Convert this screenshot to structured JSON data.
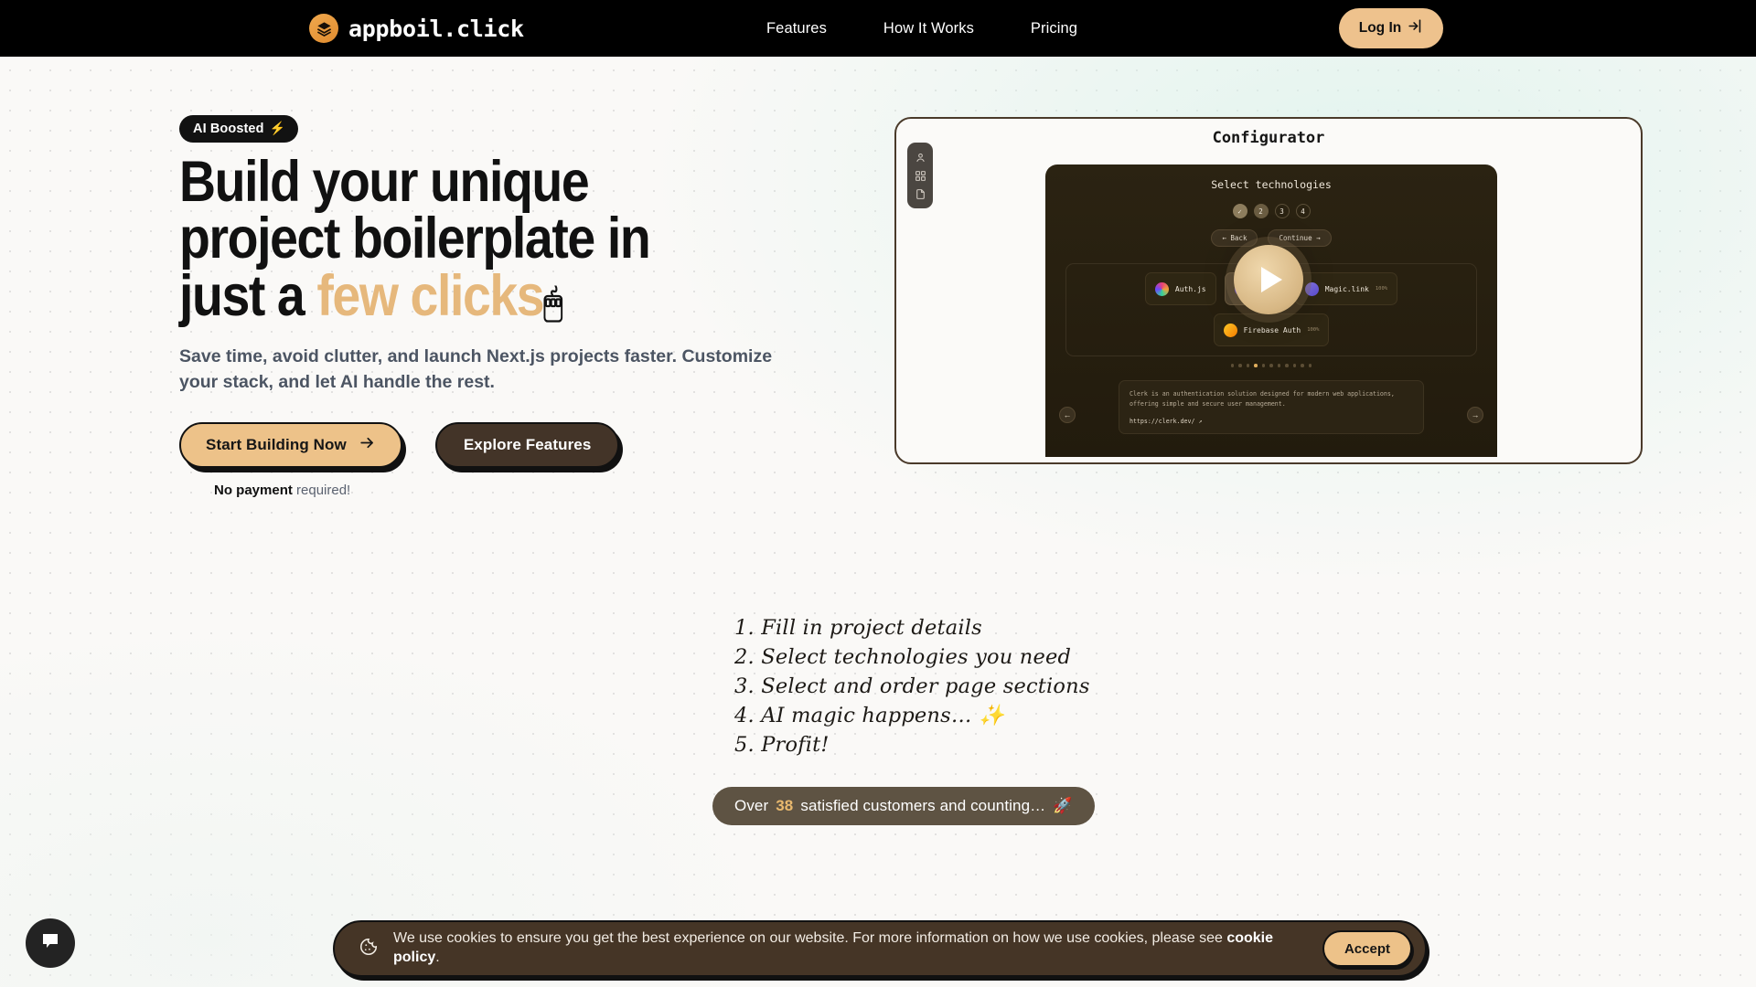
{
  "header": {
    "brand": {
      "name": "appboil.click",
      "icon": "layers-icon"
    },
    "nav": [
      {
        "label": "Features",
        "name": "nav-features"
      },
      {
        "label": "How It Works",
        "name": "nav-how-it-works"
      },
      {
        "label": "Pricing",
        "name": "nav-pricing"
      }
    ],
    "login": {
      "label": "Log In",
      "icon": "login-arrow-icon"
    }
  },
  "hero": {
    "badge": {
      "label": "AI Boosted",
      "emoji": "⚡"
    },
    "headline": {
      "line1": "Build your unique",
      "line2": "project boilerplate in",
      "line3_prefix": "just a ",
      "line3_accent": "few clicks",
      "cursor_emoji": "🖱"
    },
    "subtitle": "Save time, avoid clutter, and launch Next.js projects faster. Customize your stack, and let AI handle the rest.",
    "cta_primary": {
      "label": "Start Building Now",
      "icon": "arrow-right-icon"
    },
    "cta_secondary": {
      "label": "Explore Features"
    },
    "no_payment_bold": "No payment",
    "no_payment_rest": " required!"
  },
  "preview": {
    "title": "Configurator",
    "sidebar_icons": [
      "user-icon",
      "grid-icon",
      "document-icon"
    ],
    "panel_heading": "Select technologies",
    "steps": [
      {
        "label": "✓",
        "state": "done"
      },
      {
        "label": "2",
        "state": "cur"
      },
      {
        "label": "3",
        "state": "todo"
      },
      {
        "label": "4",
        "state": "todo"
      }
    ],
    "back_label": "← Back",
    "continue_label": "Continue →",
    "tech_cards_row1": [
      {
        "label": "Auth.js",
        "color1": "#e8407a",
        "color2": "#7b5cf0",
        "selected": false,
        "pct": ""
      },
      {
        "label": "Clerk",
        "color1": "#6c47ff",
        "color2": "#3b2bb8",
        "selected": true,
        "pct": ""
      },
      {
        "label": "Magic.link",
        "color1": "#7b68ee",
        "color2": "#5a4bd0",
        "selected": false,
        "pct": "100%"
      }
    ],
    "tech_cards_row2": [
      {
        "label": "Firebase Auth",
        "color1": "#ffca28",
        "color2": "#f57c00",
        "selected": false,
        "pct": "100%"
      }
    ],
    "description": "Clerk is an authentication solution designed for modern web applications, offering simple and secure user management.",
    "description_link": "https://clerk.dev/",
    "prev_arrow": "←",
    "next_arrow": "→",
    "play_button": "play-icon",
    "dots_total": 11,
    "dots_active": 4
  },
  "steps_list": [
    "1. Fill in project details",
    "2. Select technologies you need",
    "3. Select and order page sections",
    "4. AI magic happens…",
    "5. Profit!"
  ],
  "steps_sparkle": "✨",
  "customers": {
    "prefix": "Over ",
    "count": "38",
    "suffix": " satisfied customers and counting…",
    "emoji": "🚀"
  },
  "cookie": {
    "icon": "cookie-icon",
    "text_before": "We use cookies to ensure you get the best experience on our website. For more information on how we use cookies, please see ",
    "link": "cookie policy",
    "text_after": ".",
    "accept_label": "Accept"
  },
  "chat": {
    "icon": "chat-bubble-icon"
  },
  "colors": {
    "accent": "#e6b87c",
    "brand_orange": "#e08b2e",
    "dark_brown": "#453526",
    "header_bg": "#000000",
    "page_bg": "#faf9f7"
  }
}
